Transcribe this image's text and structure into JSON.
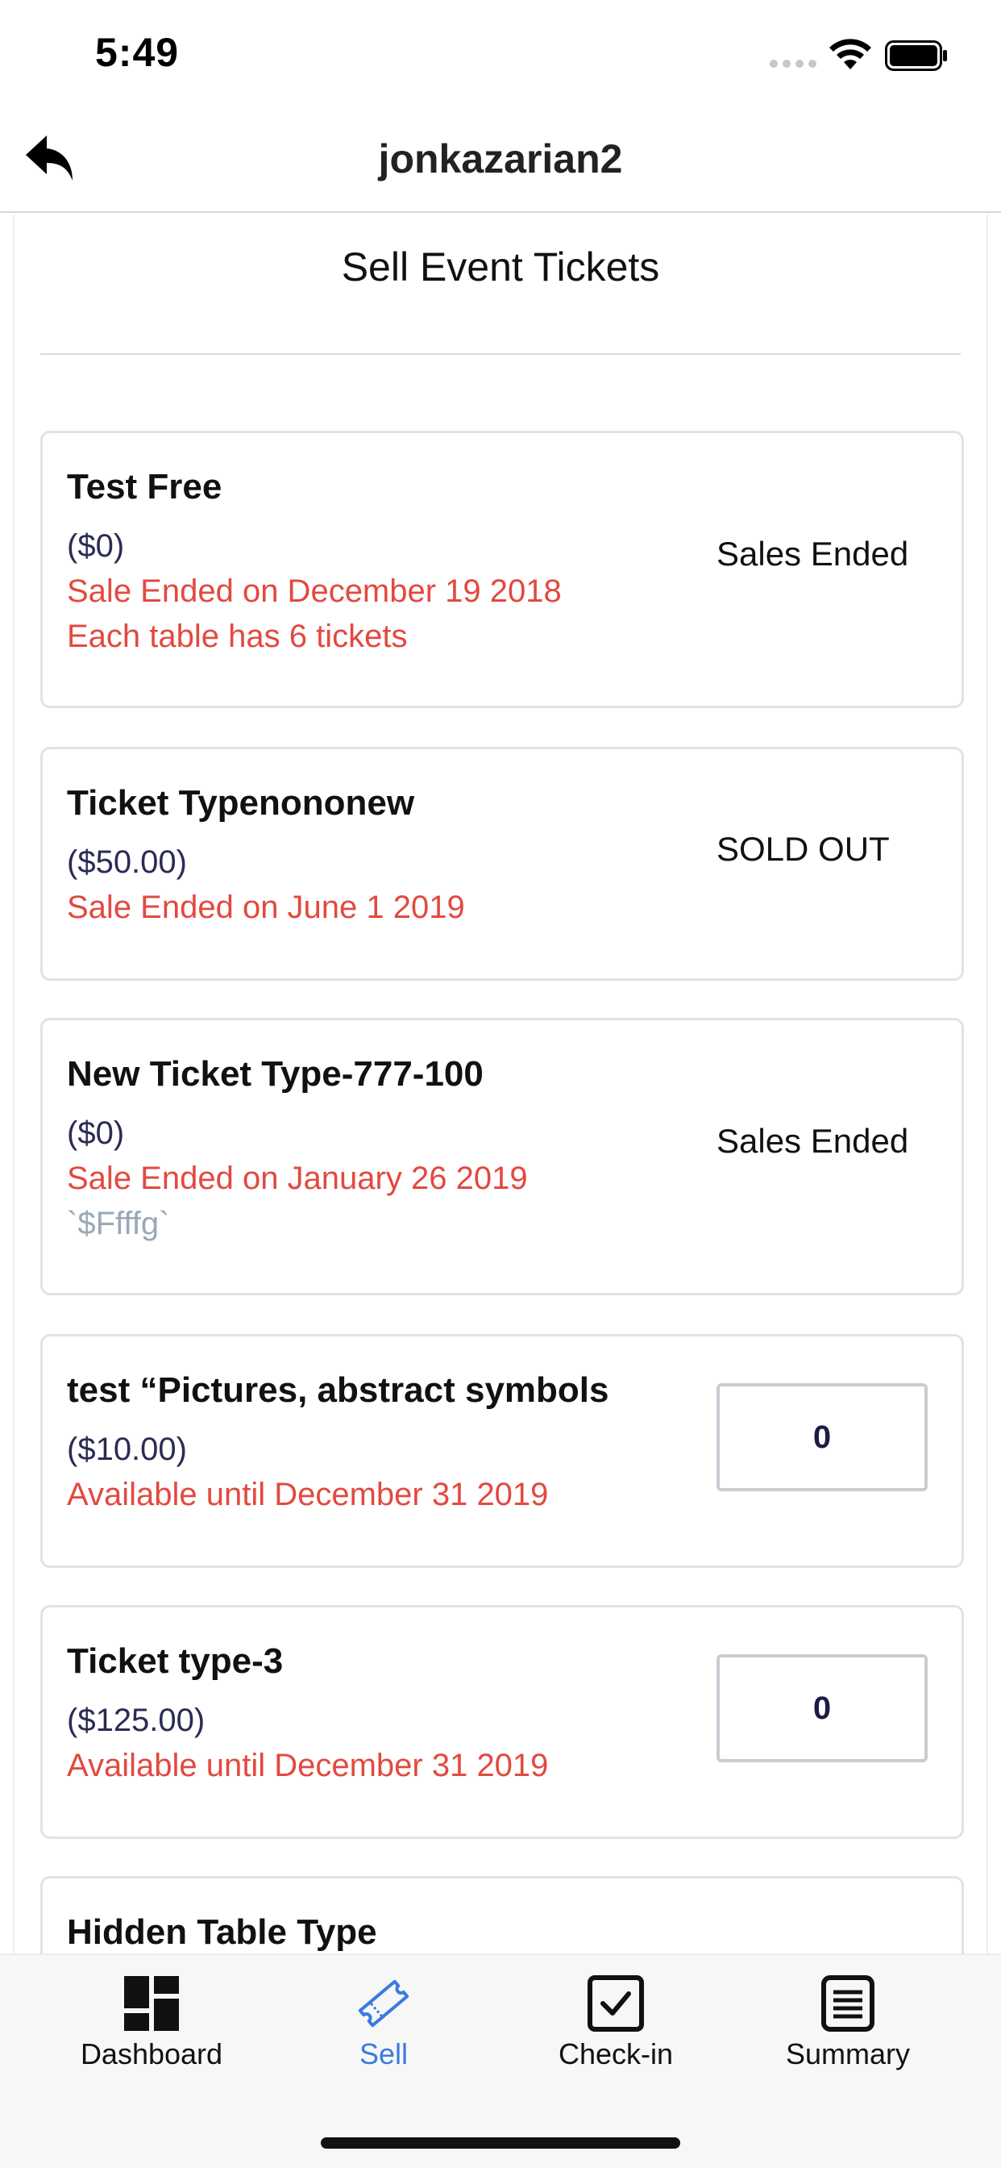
{
  "status_bar": {
    "time": "5:49"
  },
  "nav": {
    "title": "jonkazarian2",
    "back_icon": "back-arrow-icon"
  },
  "page": {
    "title": "Sell Event Tickets"
  },
  "tickets": [
    {
      "name": "Test Free",
      "price": "($0)",
      "sale_info": "Sale Ended on December 19 2018",
      "extra": "Each table has 6 tickets",
      "status": "Sales Ended"
    },
    {
      "name": "Ticket Typenononew",
      "price": "($50.00)",
      "sale_info": "Sale Ended on June 1 2019",
      "status": "SOLD OUT"
    },
    {
      "name": "New Ticket Type-777-100",
      "price": "($0)",
      "sale_info": "Sale Ended on January 26 2019",
      "note": "`$Ffffg`",
      "status": "Sales Ended"
    },
    {
      "name": " test “Pictures, abstract symbols",
      "price": "($10.00)",
      "sale_info": "Available until December 31 2019",
      "quantity": "0"
    },
    {
      "name": "Ticket type-3",
      "price": "($125.00)",
      "sale_info": "Available until December 31 2019",
      "quantity": "0"
    },
    {
      "name": "Hidden Table Type"
    }
  ],
  "tabs": [
    {
      "label": "Dashboard",
      "icon": "dashboard-icon",
      "active": false
    },
    {
      "label": "Sell",
      "icon": "ticket-icon",
      "active": true
    },
    {
      "label": "Check-in",
      "icon": "checkbox-icon",
      "active": false
    },
    {
      "label": "Summary",
      "icon": "list-icon",
      "active": false
    }
  ],
  "colors": {
    "accent": "#3b7ae0",
    "sale_red": "#e2493f",
    "price_navy": "#2b2c55",
    "note_gray": "#9aa8b6"
  }
}
